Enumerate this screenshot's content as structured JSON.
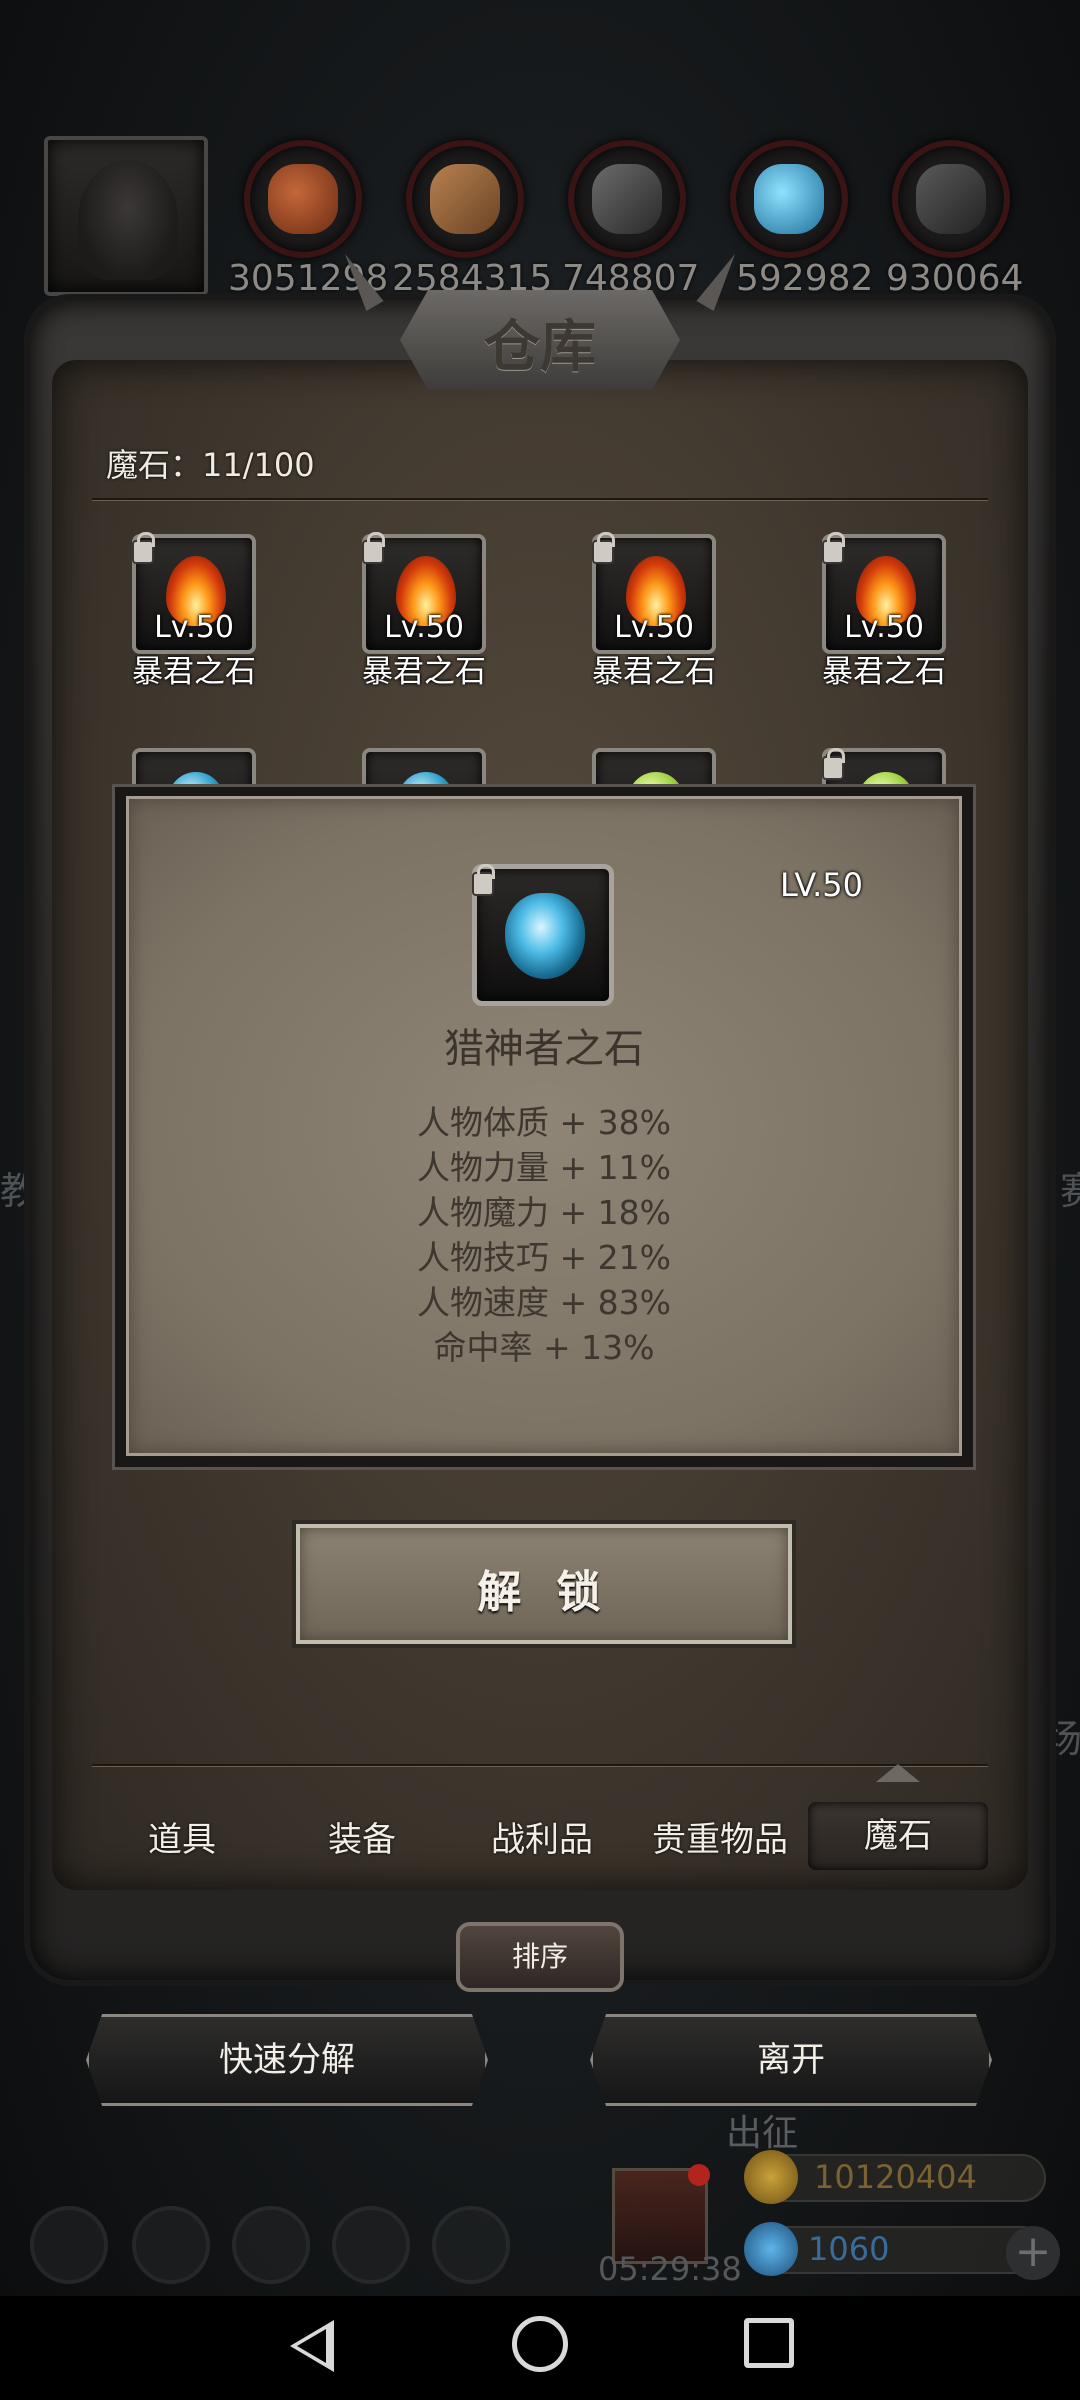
{
  "resources": {
    "values": [
      "3051298",
      "2584315",
      "748807",
      "592982",
      "930064"
    ],
    "icons": [
      "meat-icon",
      "wood-icon",
      "iron-icon",
      "crystal-icon",
      "stone-icon"
    ]
  },
  "warehouse": {
    "title": "仓库",
    "count_label": "魔石：11/100",
    "slots_row1": [
      {
        "level": "Lv.50",
        "name": "暴君之石"
      },
      {
        "level": "Lv.50",
        "name": "暴君之石"
      },
      {
        "level": "Lv.50",
        "name": "暴君之石"
      },
      {
        "level": "Lv.50",
        "name": "暴君之石"
      }
    ]
  },
  "detail": {
    "level": "LV.50",
    "name": "猎神者之石",
    "stats": [
      "人物体质 + 38%",
      "人物力量 + 11%",
      "人物魔力 + 18%",
      "人物技巧 + 21%",
      "人物速度 + 83%",
      "命中率 + 13%"
    ],
    "unlock_label": "解 锁"
  },
  "tabs": [
    {
      "label": "道具"
    },
    {
      "label": "装备"
    },
    {
      "label": "战利品"
    },
    {
      "label": "贵重物品"
    },
    {
      "label": "魔石",
      "active": true
    }
  ],
  "sort_label": "排序",
  "actions": {
    "decompose": "快速分解",
    "leave": "离开"
  },
  "hud": {
    "expedition": "出征",
    "gold": "10120404",
    "gems": "1060",
    "timer": "05:29:38"
  },
  "colors": {
    "panel": "#3e362d",
    "popup": "#8a8072",
    "accent_red": "#b3251c"
  }
}
